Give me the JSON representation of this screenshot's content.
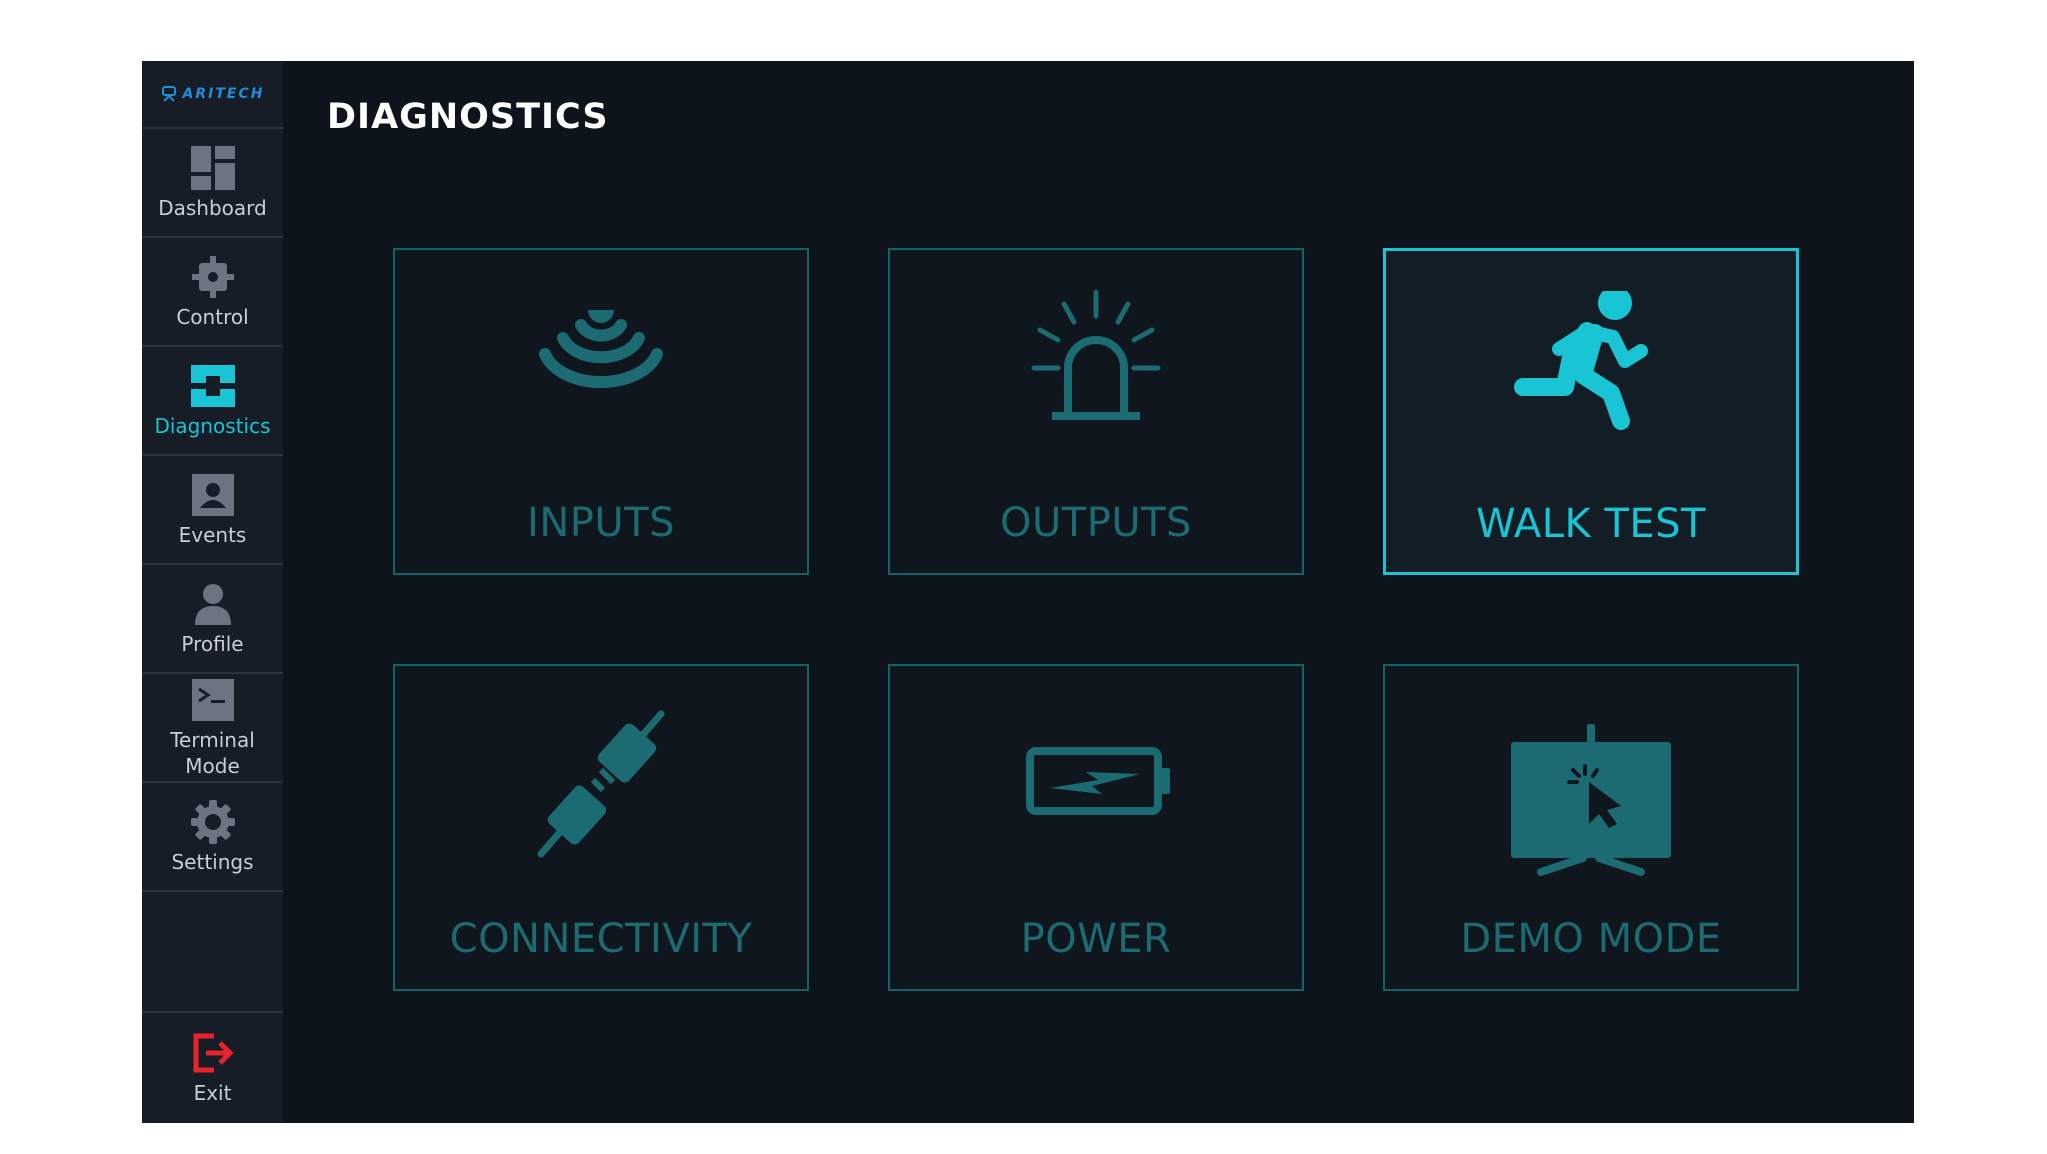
{
  "app": {
    "logo_text": "ARITECH"
  },
  "page": {
    "title": "DIAGNOSTICS"
  },
  "sidebar": {
    "items": [
      {
        "label": "Dashboard",
        "icon": "dashboard-icon"
      },
      {
        "label": "Control",
        "icon": "control-icon"
      },
      {
        "label": "Diagnostics",
        "icon": "diagnostics-icon",
        "active": true
      },
      {
        "label": "Events",
        "icon": "events-icon"
      },
      {
        "label": "Profile",
        "icon": "profile-icon"
      },
      {
        "label": "Terminal Mode",
        "icon": "terminal-icon"
      },
      {
        "label": "Settings",
        "icon": "gear-icon"
      }
    ],
    "exit_label": "Exit"
  },
  "tiles": [
    {
      "label": "INPUTS",
      "icon": "sensor-waves-icon"
    },
    {
      "label": "OUTPUTS",
      "icon": "siren-icon"
    },
    {
      "label": "WALK TEST",
      "icon": "running-person-icon",
      "selected": true
    },
    {
      "label": "CONNECTIVITY",
      "icon": "plug-connector-icon"
    },
    {
      "label": "POWER",
      "icon": "battery-charging-icon"
    },
    {
      "label": "DEMO MODE",
      "icon": "presentation-board-icon"
    }
  ],
  "colors": {
    "accent": "#19c4d4",
    "muted_teal": "#1c6b73",
    "background": "#0e141b",
    "sidebar": "#161d26",
    "exit": "#e8232e"
  }
}
